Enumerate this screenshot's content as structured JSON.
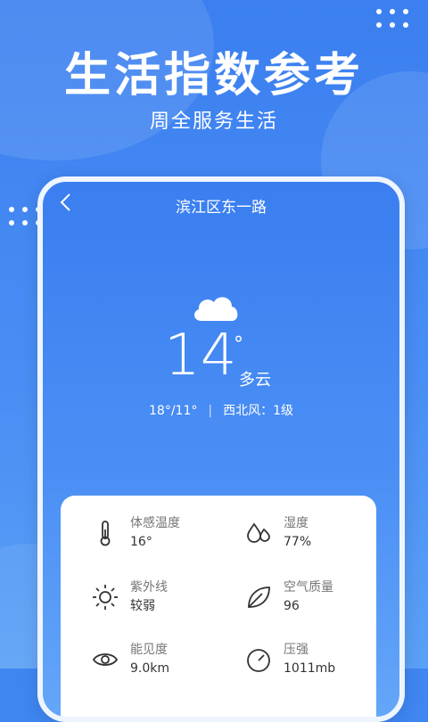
{
  "promo": {
    "title": "生活指数参考",
    "subtitle": "周全服务生活"
  },
  "header": {
    "location": "滨江区东一路"
  },
  "weather": {
    "temperature": "14",
    "degree_symbol": "°",
    "condition": "多云",
    "range": "18°/11°",
    "wind": "西北风：1级",
    "icon": "cloud-icon"
  },
  "indices": [
    {
      "label": "体感温度",
      "value": "16°",
      "icon": "thermometer-icon"
    },
    {
      "label": "湿度",
      "value": "77%",
      "icon": "humidity-icon"
    },
    {
      "label": "紫外线",
      "value": "较弱",
      "icon": "sun-icon"
    },
    {
      "label": "空气质量",
      "value": "96",
      "icon": "leaf-icon"
    },
    {
      "label": "能见度",
      "value": "9.0km",
      "icon": "eye-icon"
    },
    {
      "label": "压强",
      "value": "1011mb",
      "icon": "gauge-icon"
    }
  ],
  "colors": {
    "primary": "#3f86f1",
    "card": "#ffffff"
  }
}
